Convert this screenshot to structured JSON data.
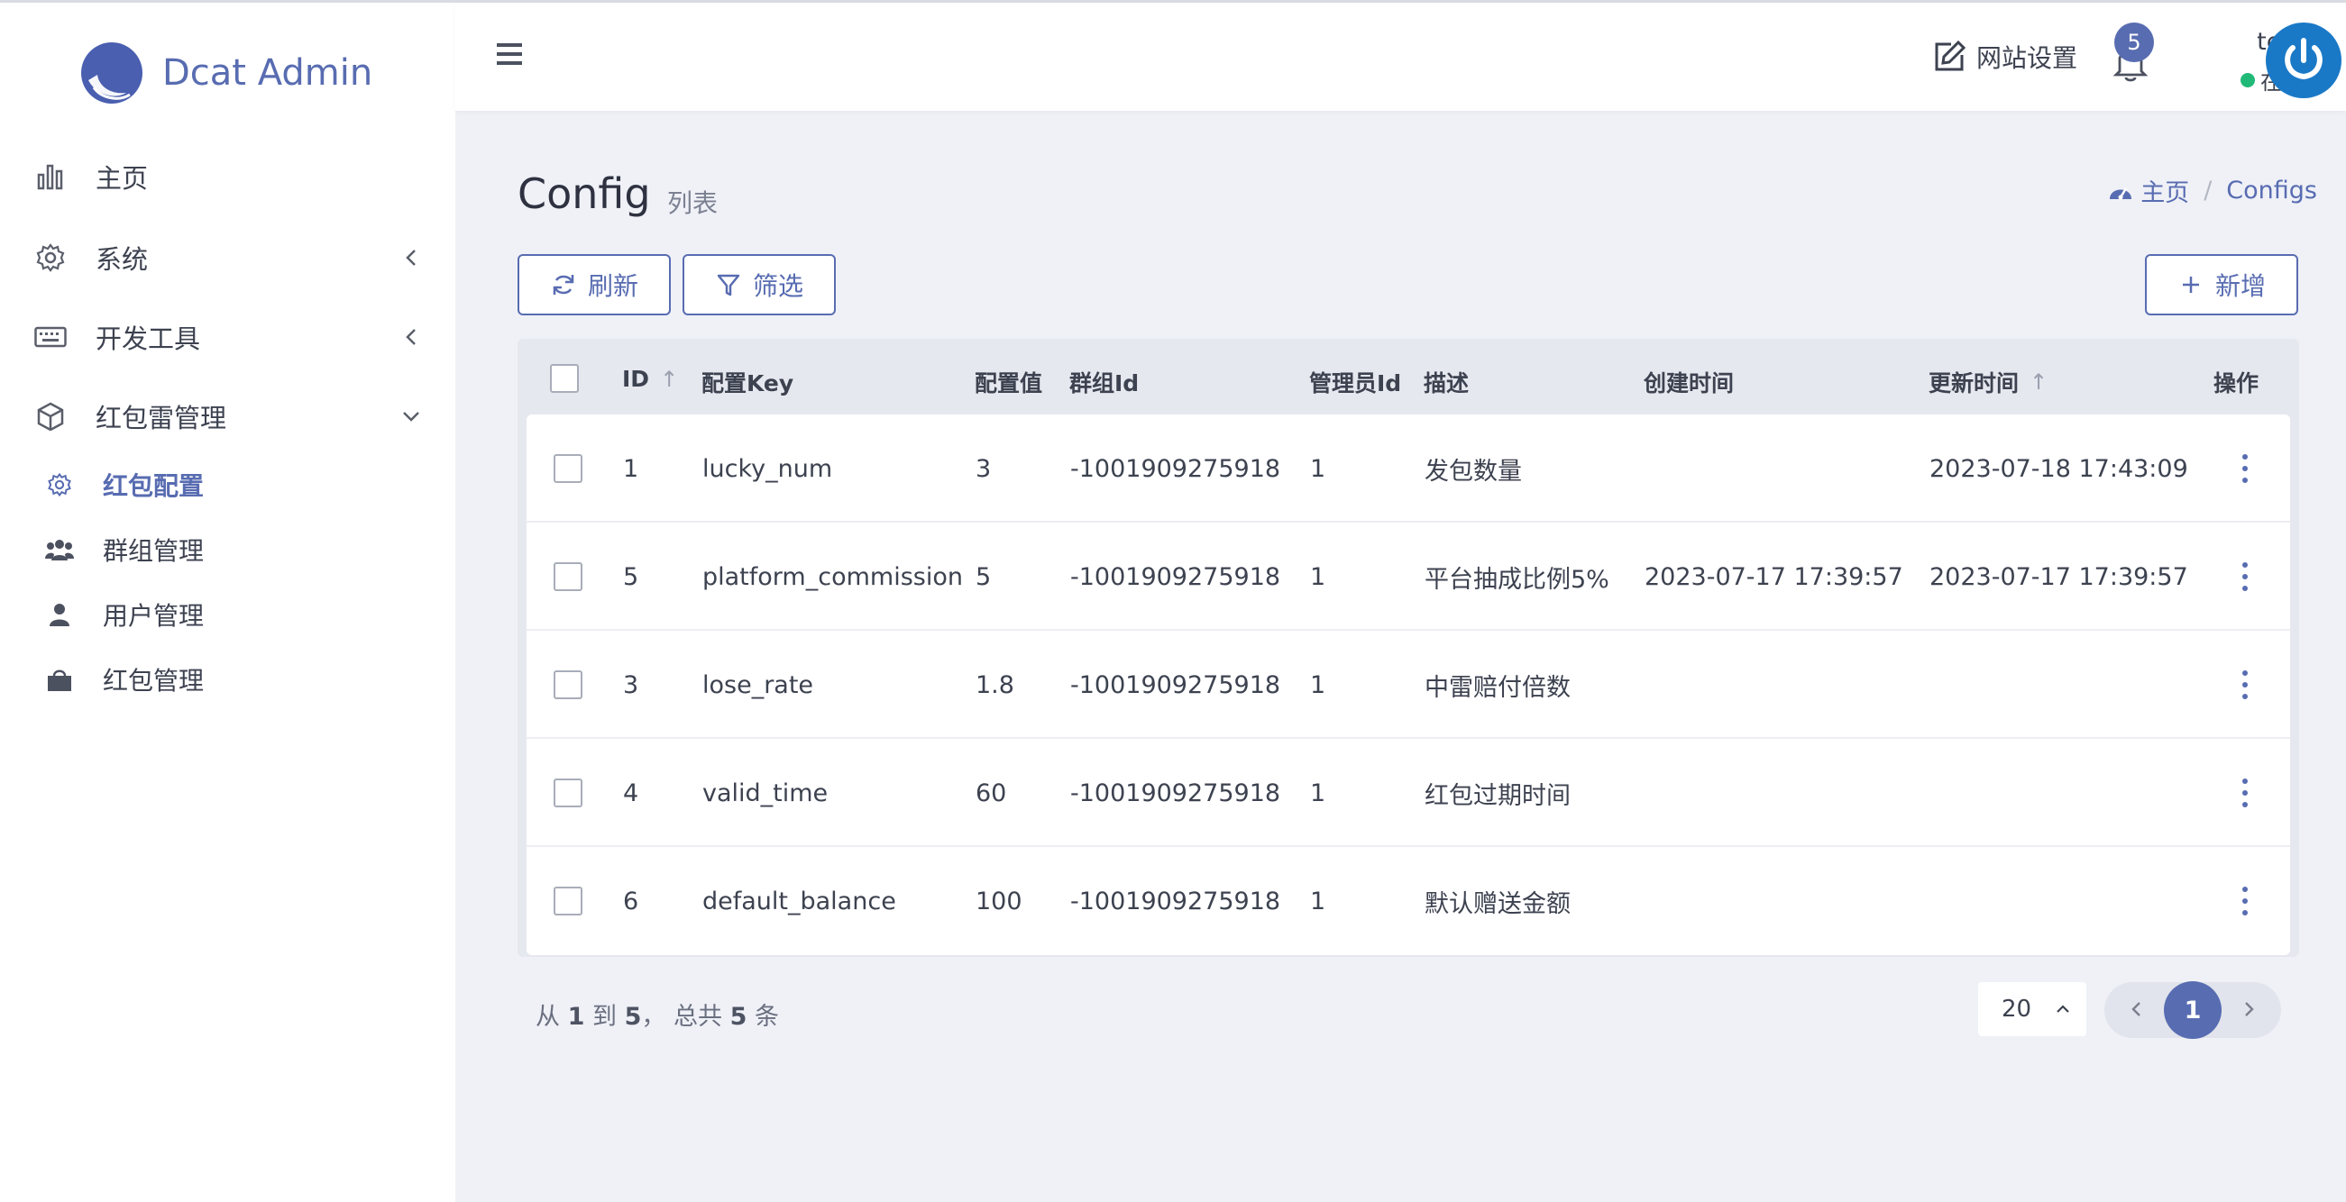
{
  "app": {
    "brand_title": "Dcat Admin"
  },
  "sidebar": {
    "items": [
      {
        "label": "主页",
        "icon": "bar-chart-icon"
      },
      {
        "label": "系统",
        "icon": "gear-icon"
      },
      {
        "label": "开发工具",
        "icon": "keyboard-icon"
      },
      {
        "label": "红包雷管理",
        "icon": "box-icon"
      }
    ],
    "sub_items": [
      {
        "label": "红包配置",
        "icon": "gear-icon",
        "active": true
      },
      {
        "label": "群组管理",
        "icon": "users-icon"
      },
      {
        "label": "用户管理",
        "icon": "user-icon"
      },
      {
        "label": "红包管理",
        "icon": "bag-icon"
      }
    ]
  },
  "header": {
    "site_settings_label": "网站设置",
    "notification_count": "5",
    "user_name": "test",
    "user_status": "在线",
    "status_color": "#21b978"
  },
  "page": {
    "title": "Config",
    "subtitle": "列表",
    "breadcrumb_home": "主页",
    "breadcrumb_current": "Configs"
  },
  "toolbar": {
    "refresh_label": "刷新",
    "filter_label": "筛选",
    "create_label": "新增"
  },
  "table": {
    "headers": {
      "id": "ID",
      "key": "配置Key",
      "value": "配置值",
      "group_id": "群组Id",
      "admin_id": "管理员Id",
      "desc": "描述",
      "created_at": "创建时间",
      "updated_at": "更新时间",
      "actions": "操作"
    },
    "rows": [
      {
        "id": "1",
        "key": "lucky_num",
        "value": "3",
        "group_id": "-1001909275918",
        "admin_id": "1",
        "desc": "发包数量",
        "created_at": "",
        "updated_at": "2023-07-18 17:43:09"
      },
      {
        "id": "5",
        "key": "platform_commission",
        "value": "5",
        "group_id": "-1001909275918",
        "admin_id": "1",
        "desc": "平台抽成比例5%",
        "created_at": "2023-07-17 17:39:57",
        "updated_at": "2023-07-17 17:39:57"
      },
      {
        "id": "3",
        "key": "lose_rate",
        "value": "1.8",
        "group_id": "-1001909275918",
        "admin_id": "1",
        "desc": "中雷赔付倍数",
        "created_at": "",
        "updated_at": ""
      },
      {
        "id": "4",
        "key": "valid_time",
        "value": "60",
        "group_id": "-1001909275918",
        "admin_id": "1",
        "desc": "红包过期时间",
        "created_at": "",
        "updated_at": ""
      },
      {
        "id": "6",
        "key": "default_balance",
        "value": "100",
        "group_id": "-1001909275918",
        "admin_id": "1",
        "desc": "默认赠送金额",
        "created_at": "",
        "updated_at": ""
      }
    ]
  },
  "footer": {
    "summary_from_label": "从",
    "summary_from": "1",
    "summary_to_label": "到",
    "summary_to": "5",
    "summary_total_label": "， 总共",
    "summary_total": "5",
    "summary_unit": "条",
    "per_page": "20",
    "current_page": "1"
  },
  "colors": {
    "accent": "#586cb1",
    "background": "#eff1f7",
    "avatar": "#1a79c7"
  }
}
